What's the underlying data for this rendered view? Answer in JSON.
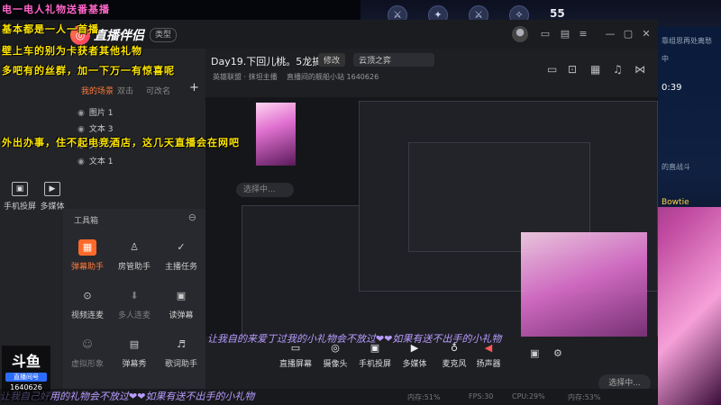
{
  "game": {
    "coins": "55",
    "panel_lines": [
      "靠组思再处离愁",
      "中",
      "0:39",
      "的直战斗"
    ],
    "brand": "Bowtie"
  },
  "window": {
    "app_title": "直播伴侣",
    "mode_badge": "类型",
    "icons": [
      "avatar-icon",
      "message-icon",
      "shirt-icon",
      "menu-icon",
      "minimize-icon",
      "maximize-icon",
      "close-icon"
    ]
  },
  "left_panel": {
    "tabs": [
      "我的场景",
      "双击",
      "可改名"
    ],
    "add": "+",
    "scenes": [
      "图片 1",
      "文本 3",
      "文本 2",
      "文本 1"
    ],
    "buttons": [
      "手机投屏",
      "多媒体"
    ],
    "toolbox": {
      "title": "工具箱",
      "tools": [
        {
          "label": "弹幕助手",
          "icon": "▦"
        },
        {
          "label": "房管助手",
          "icon": "♙"
        },
        {
          "label": "主播任务",
          "icon": "✓"
        },
        {
          "label": "视频连麦",
          "icon": "⊙"
        },
        {
          "label": "多人连麦",
          "icon": "⬇"
        },
        {
          "label": "读弹幕",
          "icon": "▣"
        },
        {
          "label": "虚拟形象",
          "icon": "☺"
        },
        {
          "label": "弹幕秀",
          "icon": "▤"
        },
        {
          "label": "歌词助手",
          "icon": "♬"
        }
      ]
    }
  },
  "stream": {
    "title": "Day19.下回儿桃。5龙搞三星",
    "edit": "修改",
    "category": "云顶之弈",
    "sub": "英雄联盟 · 抹坦主播",
    "room": "直播间的舰船小站 1640626",
    "chat_placeholder": "选择中..."
  },
  "bottom": {
    "buttons": [
      "直播屏幕",
      "摄像头",
      "手机投屏",
      "多媒体",
      "麦克风",
      "扬声器"
    ],
    "go_live": "选择中...",
    "status": [
      "内存:51%",
      "FPS:30",
      "CPU:29%",
      "内存:53%"
    ]
  },
  "overlays": [
    "电一电人礼物送番基播",
    "基本都是一人一首播",
    "壁上车的别为卡获者其他礼物",
    "多吧有的丝群，加一下万一有惊喜呢",
    "外出办事，住不起电竞酒店，这几天直播会在网吧"
  ],
  "danmu": [
    "让我自的来爱丁过我的小礼物会不放过❤❤如果有送不出手的小礼物",
    "让我自己好用的礼物会不放过❤❤如果有送不出手的小礼物"
  ],
  "douyu": {
    "logo": "斗鱼",
    "tag": "直播间号",
    "room_id": "1640626"
  }
}
